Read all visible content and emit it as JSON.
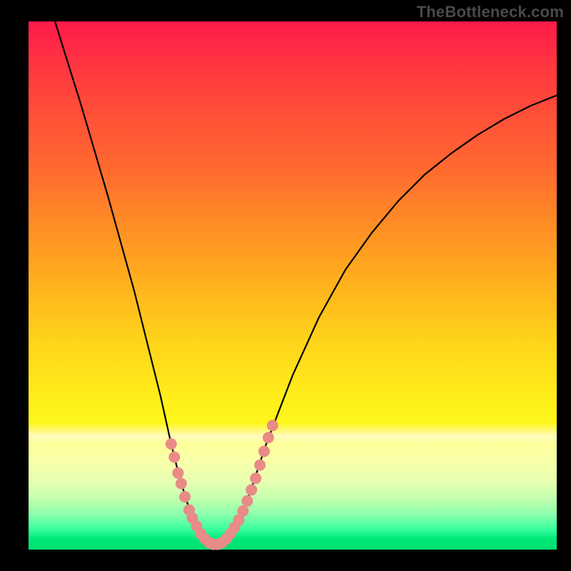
{
  "watermark": "TheBottleneck.com",
  "chart_data": {
    "type": "line",
    "title": "",
    "xlabel": "",
    "ylabel": "",
    "xlim": [
      0,
      100
    ],
    "ylim": [
      0,
      100
    ],
    "series": [
      {
        "name": "bottleneck-curve",
        "x": [
          5,
          10,
          15,
          20,
          22,
          25,
          27,
          28.5,
          30,
          31,
          32,
          33,
          34,
          35,
          36,
          37,
          38,
          39,
          40,
          42,
          45,
          50,
          55,
          60,
          65,
          70,
          75,
          80,
          85,
          90,
          95,
          100
        ],
        "values": [
          100,
          84,
          67,
          49,
          41,
          29,
          20,
          14,
          9,
          6,
          4,
          2.5,
          1.5,
          1,
          1,
          1.5,
          2.5,
          4,
          6,
          11,
          20,
          33,
          44,
          53,
          60,
          66,
          71,
          75,
          78.5,
          81.5,
          84,
          86
        ]
      }
    ],
    "markers": {
      "name": "salmon-dots",
      "color": "#e98b87",
      "radius_css_px": 8,
      "points": [
        {
          "x": 27.0,
          "y": 20.0
        },
        {
          "x": 27.6,
          "y": 17.5
        },
        {
          "x": 28.3,
          "y": 14.5
        },
        {
          "x": 28.9,
          "y": 12.5
        },
        {
          "x": 29.6,
          "y": 10.0
        },
        {
          "x": 30.4,
          "y": 7.5
        },
        {
          "x": 31.0,
          "y": 6.0
        },
        {
          "x": 31.8,
          "y": 4.5
        },
        {
          "x": 32.6,
          "y": 3.0
        },
        {
          "x": 33.4,
          "y": 2.0
        },
        {
          "x": 34.2,
          "y": 1.3
        },
        {
          "x": 35.0,
          "y": 1.0
        },
        {
          "x": 35.8,
          "y": 1.0
        },
        {
          "x": 36.6,
          "y": 1.3
        },
        {
          "x": 37.4,
          "y": 2.0
        },
        {
          "x": 38.2,
          "y": 3.0
        },
        {
          "x": 39.0,
          "y": 4.2
        },
        {
          "x": 39.8,
          "y": 5.6
        },
        {
          "x": 40.6,
          "y": 7.3
        },
        {
          "x": 41.4,
          "y": 9.2
        },
        {
          "x": 42.2,
          "y": 11.3
        },
        {
          "x": 43.0,
          "y": 13.5
        },
        {
          "x": 43.8,
          "y": 16.0
        },
        {
          "x": 44.6,
          "y": 18.6
        },
        {
          "x": 45.4,
          "y": 21.2
        },
        {
          "x": 46.2,
          "y": 23.5
        }
      ]
    },
    "gradient_stops": [
      {
        "pos": 0.0,
        "color": "#ff1a4a"
      },
      {
        "pos": 0.1,
        "color": "#ff3b3f"
      },
      {
        "pos": 0.28,
        "color": "#ff6a2f"
      },
      {
        "pos": 0.45,
        "color": "#ffa21f"
      },
      {
        "pos": 0.6,
        "color": "#ffd21a"
      },
      {
        "pos": 0.72,
        "color": "#fff01a"
      },
      {
        "pos": 0.8,
        "color": "#fdff99"
      },
      {
        "pos": 0.9,
        "color": "#c9ffb0"
      },
      {
        "pos": 0.96,
        "color": "#3effa0"
      },
      {
        "pos": 1.0,
        "color": "#00e070"
      }
    ]
  }
}
